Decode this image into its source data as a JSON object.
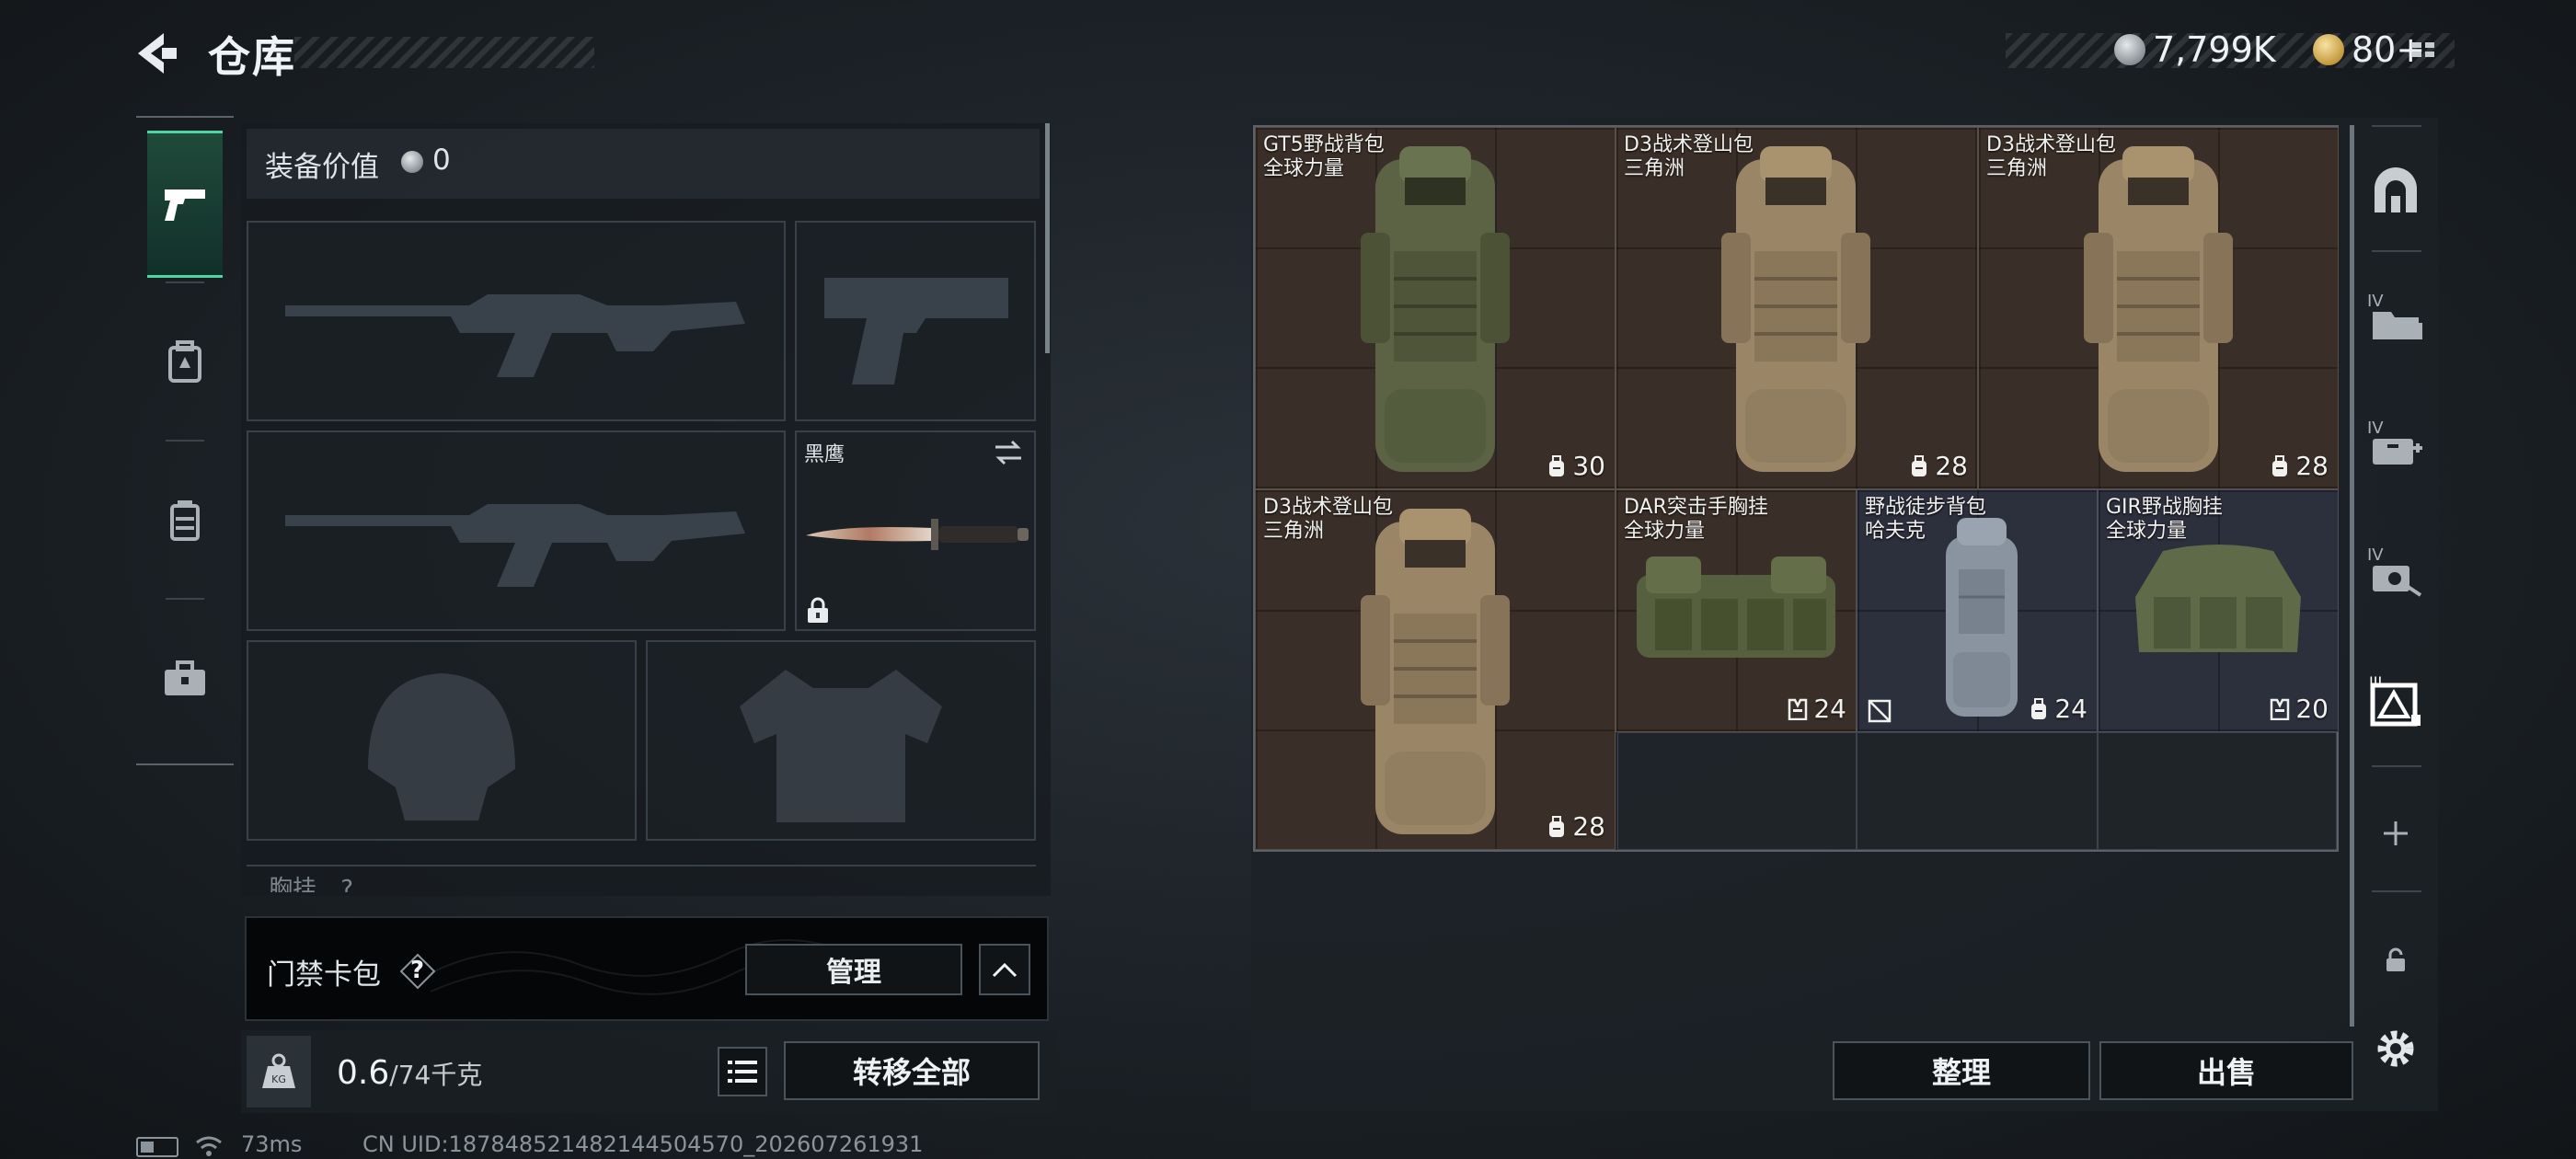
{
  "header": {
    "title": "仓库",
    "currency": [
      {
        "icon": "silver-coin-icon",
        "value": "7,799K"
      },
      {
        "icon": "gold-coin-icon",
        "value": "80+"
      }
    ]
  },
  "left_tabs": [
    {
      "name": "tab-weapons",
      "icon": "pistol-icon",
      "active": true
    },
    {
      "name": "tab-backpack",
      "icon": "backpack-ammo-icon",
      "active": false
    },
    {
      "name": "tab-container",
      "icon": "container-icon",
      "active": false
    },
    {
      "name": "tab-medkit",
      "icon": "toolbox-icon",
      "active": false
    }
  ],
  "equipment": {
    "value_label": "装备价值",
    "value": "0",
    "melee_name": "黑鹰",
    "chest_label": "胸挂",
    "chest_q": "?"
  },
  "access_card": {
    "label": "门禁卡包",
    "help": "?",
    "manage_label": "管理"
  },
  "weight": {
    "current": "0.6",
    "max": "/74千克",
    "transfer_label": "转移全部"
  },
  "status": {
    "ping": "73ms",
    "uid": "CN UID:187848521482144504570_202607261931"
  },
  "stash": {
    "items": [
      {
        "name": "GT5野战背包",
        "maker": "全球力量",
        "cap": "30",
        "cap_icon": "backpack-capacity-icon",
        "color": "green"
      },
      {
        "name": "D3战术登山包",
        "maker": "三角洲",
        "cap": "28",
        "cap_icon": "backpack-capacity-icon",
        "color": "tan"
      },
      {
        "name": "D3战术登山包",
        "maker": "三角洲",
        "cap": "28",
        "cap_icon": "backpack-capacity-icon",
        "color": "tan"
      },
      {
        "name": "D3战术登山包",
        "maker": "三角洲",
        "cap": "28",
        "cap_icon": "backpack-capacity-icon",
        "color": "tan"
      },
      {
        "name": "DAR突击手胸挂",
        "maker": "全球力量",
        "cap": "24",
        "cap_icon": "vest-capacity-icon",
        "color": "green"
      },
      {
        "name": "野战徒步背包",
        "maker": "哈夫克",
        "cap": "24",
        "cap_icon": "backpack-capacity-icon",
        "color": "grey"
      },
      {
        "name": "GIR野战胸挂",
        "maker": "全球力量",
        "cap": "20",
        "cap_icon": "vest-capacity-icon",
        "color": "green"
      }
    ],
    "sort_label": "整理",
    "sell_label": "出售"
  },
  "right_sidebar": [
    "home-arch-icon",
    "storage-iv-folder-icon",
    "storage-iv-medical-icon",
    "storage-iv-key-icon",
    "storage-iii-triangle-icon",
    "add-icon",
    "lock-icon",
    "settings-gear-icon"
  ],
  "colors": {
    "accent": "#4fd6a0",
    "item_cell_brown": "#3a2f28",
    "item_cell_blue": "#2c2f3c"
  }
}
